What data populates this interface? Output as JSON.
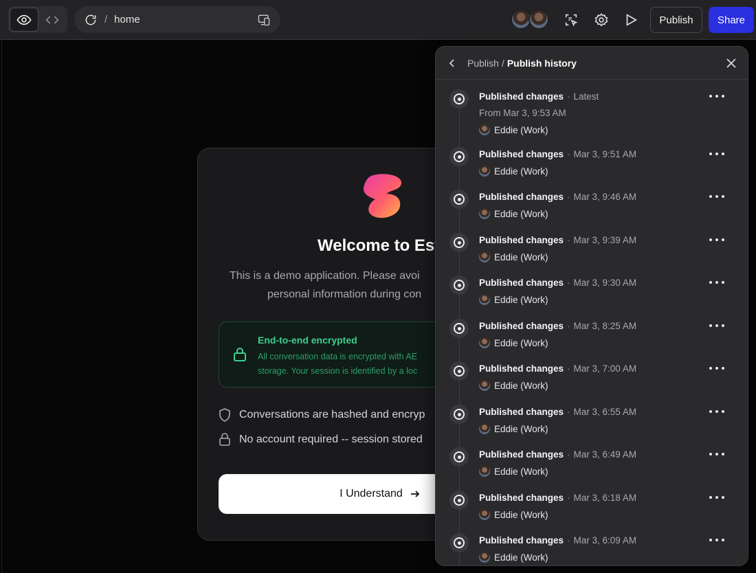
{
  "toolbar": {
    "url_path": "home",
    "publish_label": "Publish",
    "share_label": "Share",
    "icons": [
      "eye-icon",
      "code-icon",
      "refresh-icon",
      "devices-icon",
      "inspect-icon",
      "gear-icon",
      "play-icon"
    ]
  },
  "preview": {
    "card_title": "Welcome to Est",
    "desc_line1": "This is a demo application. Please avoi",
    "desc_line2": "personal information during con",
    "encryption_title": "End-to-end encrypted",
    "encryption_line1": "All conversation data is encrypted with AE",
    "encryption_line2": "storage. Your session is identified by a loc",
    "feature_1": "Conversations are hashed and encryp",
    "feature_2": "No account required -- session stored",
    "button_label": "I Understand"
  },
  "panel": {
    "breadcrumb_parent": "Publish",
    "breadcrumb_separator": "/",
    "breadcrumb_current": "Publish history",
    "entries": [
      {
        "title": "Published changes",
        "meta": "Latest",
        "from": "From Mar 3, 9:53 AM",
        "author": "Eddie (Work)"
      },
      {
        "title": "Published changes",
        "meta": "Mar 3, 9:51 AM",
        "author": "Eddie (Work)"
      },
      {
        "title": "Published changes",
        "meta": "Mar 3, 9:46 AM",
        "author": "Eddie (Work)"
      },
      {
        "title": "Published changes",
        "meta": "Mar 3, 9:39 AM",
        "author": "Eddie (Work)"
      },
      {
        "title": "Published changes",
        "meta": "Mar 3, 9:30 AM",
        "author": "Eddie (Work)"
      },
      {
        "title": "Published changes",
        "meta": "Mar 3, 8:25 AM",
        "author": "Eddie (Work)"
      },
      {
        "title": "Published changes",
        "meta": "Mar 3, 7:00 AM",
        "author": "Eddie (Work)"
      },
      {
        "title": "Published changes",
        "meta": "Mar 3, 6:55 AM",
        "author": "Eddie (Work)"
      },
      {
        "title": "Published changes",
        "meta": "Mar 3, 6:49 AM",
        "author": "Eddie (Work)"
      },
      {
        "title": "Published changes",
        "meta": "Mar 3, 6:18 AM",
        "author": "Eddie (Work)"
      },
      {
        "title": "Published changes",
        "meta": "Mar 3, 6:09 AM",
        "author": "Eddie (Work)"
      }
    ]
  },
  "colors": {
    "share_button": "#2a2fe0",
    "encryption_green": "#3fcf8e",
    "panel_bg": "#2a2a2d"
  }
}
